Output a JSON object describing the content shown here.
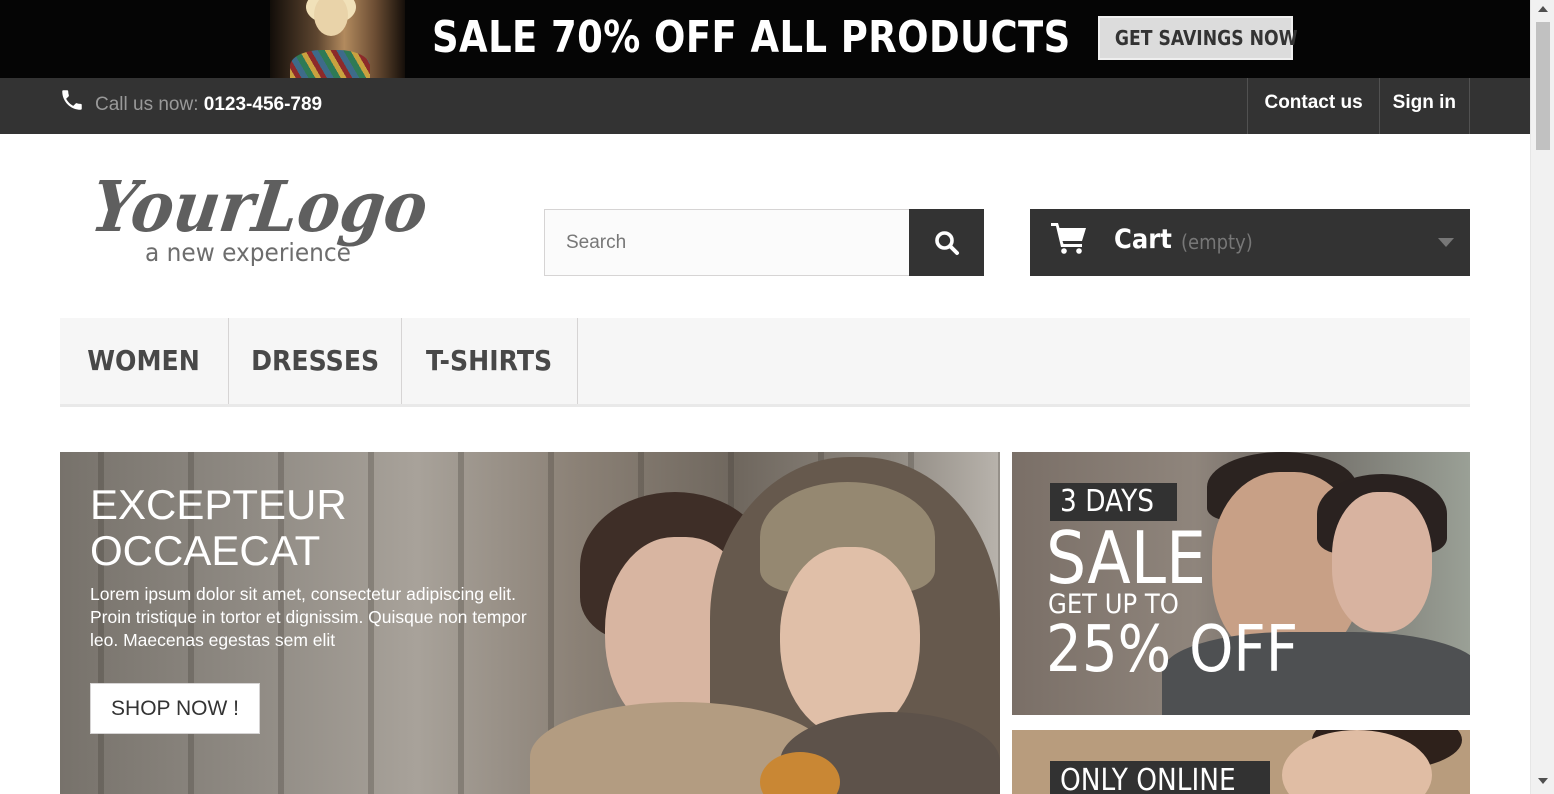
{
  "promo_banner": {
    "title": "SALE 70% OFF ALL PRODUCTS",
    "button_label": "GET SAVINGS NOW"
  },
  "nav": {
    "call_label": "Call us now: ",
    "phone_number": "0123-456-789",
    "links": [
      "Contact us",
      "Sign in"
    ],
    "icon": "phone-icon"
  },
  "header": {
    "logo_alt": "Your Logo - a new experience",
    "logo_text": "YourLogo",
    "logo_tagline": "a new experience",
    "search": {
      "placeholder": "Search",
      "value": ""
    },
    "cart": {
      "label": "Cart",
      "status": "(empty)"
    }
  },
  "menu": {
    "items": [
      "WOMEN",
      "DRESSES",
      "T-SHIRTS"
    ]
  },
  "hero": {
    "title": "EXCEPTEUR OCCAECAT",
    "text": "Lorem ipsum dolor sit amet, consectetur adipiscing elit. Proin tristique in tortor et dignissim. Quisque non tempor leo. Maecenas egestas sem elit",
    "button_label": "SHOP NOW !"
  },
  "side_banners": [
    {
      "tag": "3 DAYS",
      "headline": "SALE",
      "line": "GET UP TO",
      "offer": "25% OFF"
    },
    {
      "tag": "ONLY ONLINE"
    }
  ],
  "colors": {
    "dark": "#333333",
    "promo_bg": "#050505",
    "menu_bg": "#f6f6f6",
    "muted_text": "#777777"
  }
}
